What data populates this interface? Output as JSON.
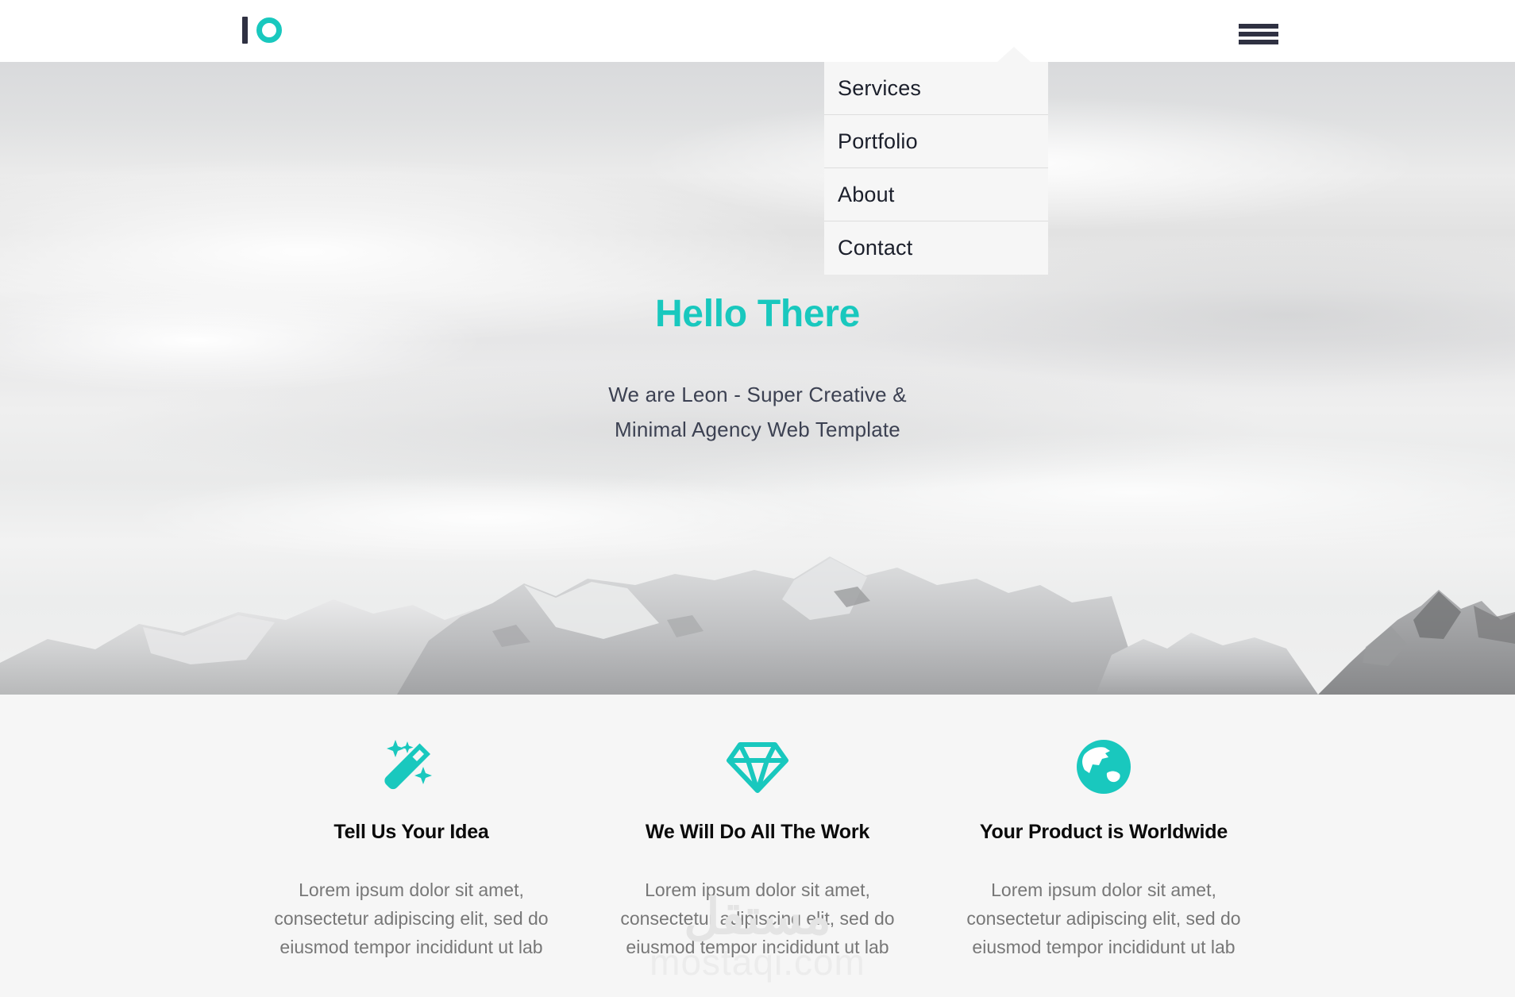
{
  "brand": {
    "logo_bar_color": "#2f3142",
    "logo_ring_color": "#19c8be",
    "accent_color": "#19c8be",
    "logo_name": "leon-logo"
  },
  "header": {
    "menu_toggle_name": "hamburger-menu-icon",
    "background": "#ffffff"
  },
  "menu": {
    "background": "#f6f6f6",
    "items": [
      {
        "label": "Services"
      },
      {
        "label": "Portfolio"
      },
      {
        "label": "About"
      },
      {
        "label": "Contact"
      }
    ]
  },
  "hero": {
    "title": "Hello There",
    "subtitle_line1": "We are Leon - Super Creative &",
    "subtitle_line2": "Minimal Agency Web Template",
    "title_color": "#19c8be",
    "subtitle_color": "#3c4152",
    "background_image": "grayscale-snow-mountains-clouds"
  },
  "features": {
    "background": "#f6f6f6",
    "items": [
      {
        "icon": "magic-wand-icon",
        "title": "Tell Us Your Idea",
        "text": "Lorem ipsum dolor sit amet, consectetur adipiscing elit, sed do eiusmod tempor incididunt ut lab"
      },
      {
        "icon": "gem-icon",
        "title": "We Will Do All The Work",
        "text": "Lorem ipsum dolor sit amet, consectetur adipiscing elit, sed do eiusmod tempor incididunt ut lab"
      },
      {
        "icon": "globe-icon",
        "title": "Your Product is Worldwide",
        "text": "Lorem ipsum dolor sit amet, consectetur adipiscing elit, sed do eiusmod tempor incididunt ut lab"
      }
    ]
  },
  "watermark": {
    "arabic": "مستقل",
    "latin": "mostaqi.com"
  }
}
